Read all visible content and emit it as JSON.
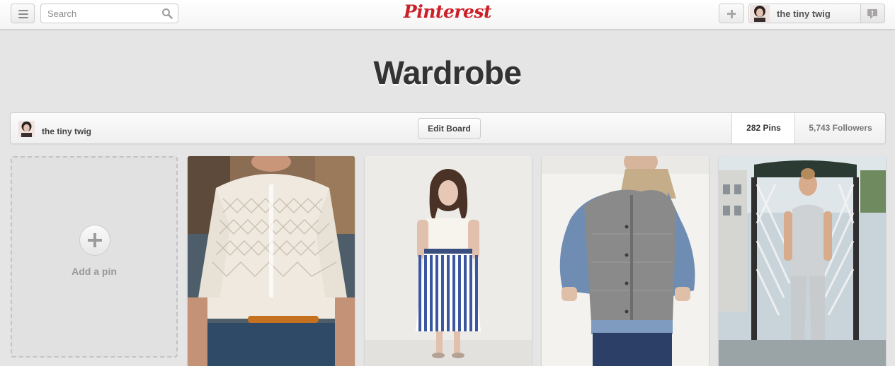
{
  "header": {
    "search_placeholder": "Search",
    "logo_text": "Pinterest",
    "user_name": "the tiny twig"
  },
  "board": {
    "title": "Wardrobe",
    "owner_name": "the tiny twig",
    "edit_label": "Edit Board",
    "pins_count": "282 Pins",
    "followers_count": "5,743 Followers"
  },
  "add_pin": {
    "label": "Add a pin"
  },
  "colors": {
    "brand": "#cb2027",
    "background": "#e6e5e5"
  },
  "pins": [
    {
      "subject": "lace-blouse-photo"
    },
    {
      "subject": "striped-skirt-photo"
    },
    {
      "subject": "tweed-vest-photo"
    },
    {
      "subject": "jumpsuit-photo"
    }
  ]
}
